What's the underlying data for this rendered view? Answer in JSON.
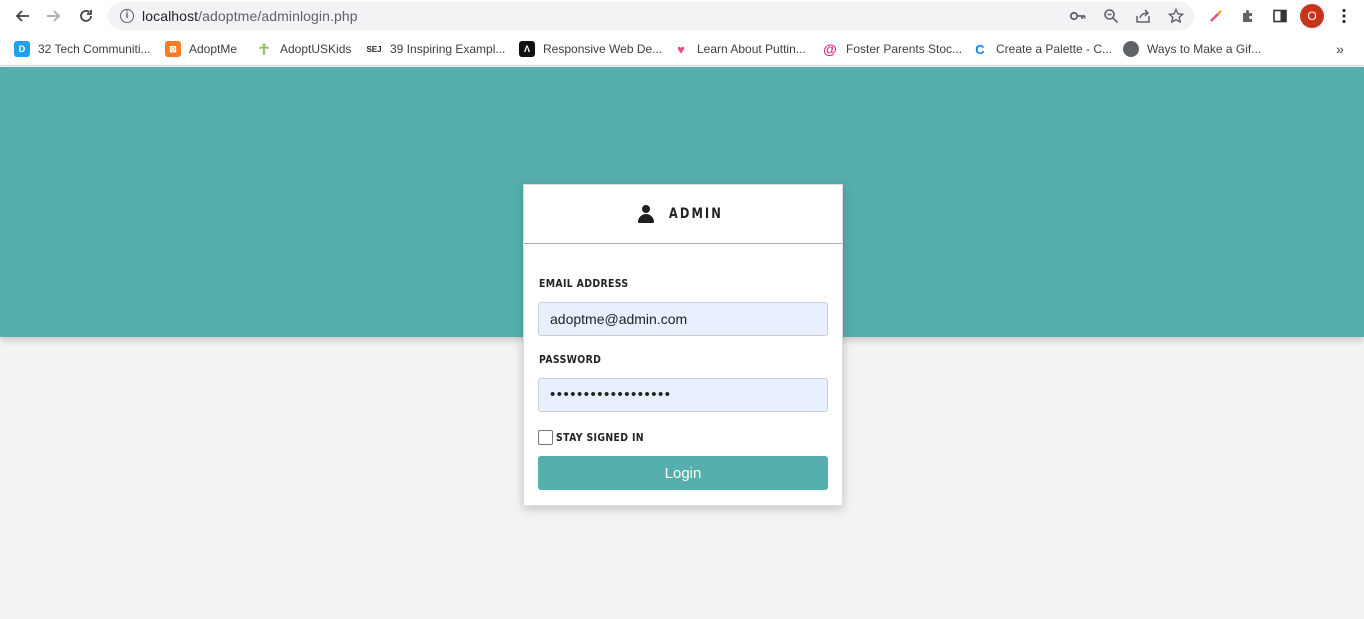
{
  "browser": {
    "url_host": "localhost",
    "url_path": "/adoptme/adminlogin.php",
    "avatar_initial": "O",
    "avatar_color": "#c6341a",
    "bookmarks": [
      {
        "label": "32 Tech Communiti...",
        "icon": "blue-square-icon",
        "color": "#1da1f2"
      },
      {
        "label": "AdoptMe",
        "icon": "xampp-icon",
        "color": "#fb7a24"
      },
      {
        "label": "AdoptUSKids",
        "icon": "person-figure-icon",
        "color": "#8ab33f"
      },
      {
        "label": "39 Inspiring Exampl...",
        "icon": "sej-icon",
        "color": "#222222"
      },
      {
        "label": "Responsive Web De...",
        "icon": "dark-logo-icon",
        "color": "#111111"
      },
      {
        "label": "Learn About Puttin...",
        "icon": "heart-icon",
        "color": "#e84c8b"
      },
      {
        "label": "Foster Parents Stoc...",
        "icon": "spiral-icon",
        "color": "#e5247e"
      },
      {
        "label": "Create a Palette - C...",
        "icon": "c-logo-icon",
        "color": "#0a84ff"
      },
      {
        "label": "Ways to Make a Gif...",
        "icon": "globe-icon",
        "color": "#5f6368"
      }
    ]
  },
  "login": {
    "title": "ADMIN",
    "email_label": "EMAIL ADDRESS",
    "email_value": "adoptme@admin.com",
    "password_label": "PASSWORD",
    "password_value": "••••••••••••••••••",
    "remember_label": "STAY SIGNED IN",
    "remember_checked": false,
    "submit_label": "Login"
  },
  "colors": {
    "accent": "#56afad",
    "background": "#f3f3f3",
    "input_bg": "#e8f0fe"
  }
}
